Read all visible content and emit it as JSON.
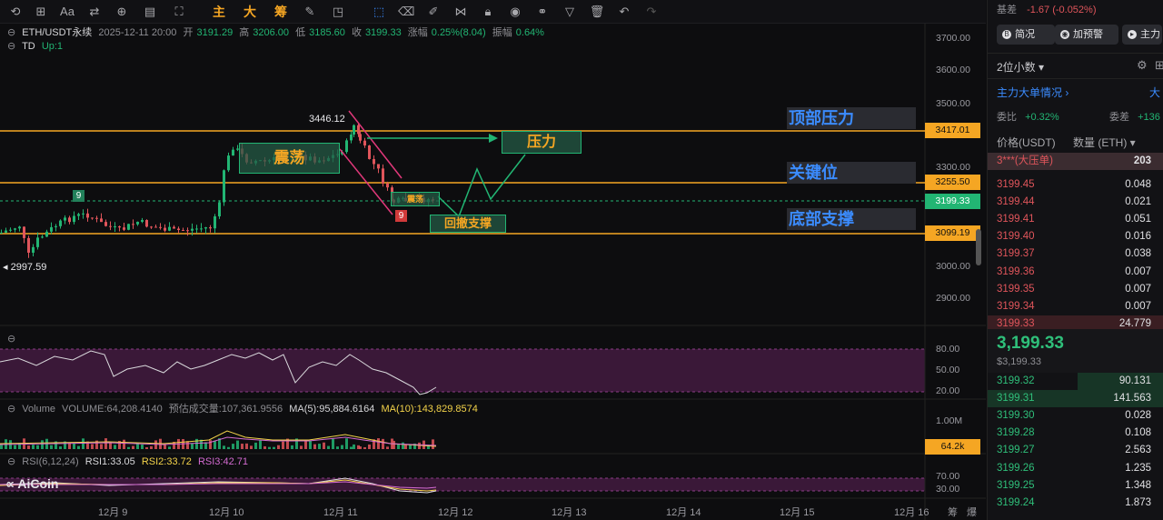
{
  "toolbar": {
    "cn_buttons": [
      "主",
      "大",
      "筹"
    ],
    "icons": [
      "reset-icon",
      "magnet-icon",
      "text-size-icon",
      "bar-style-icon",
      "indicator-icon",
      "layout-icon",
      "fullscreen-icon",
      "edit-icon",
      "screenshot-icon",
      "select-icon",
      "eraser-icon",
      "brush-icon",
      "pattern-icon",
      "lock-icon",
      "eye-icon",
      "link-icon",
      "filter-icon",
      "trash-icon",
      "undo-icon",
      "redo-icon"
    ]
  },
  "chart": {
    "symbol": "ETH/USDT永续",
    "datetime": "2025-12-11 20:00",
    "open_label": "开",
    "open": "3191.29",
    "high_label": "高",
    "high": "3206.00",
    "low_label": "低",
    "low": "3185.60",
    "close_label": "收",
    "close": "3199.33",
    "change_label": "涨幅",
    "change": "0.25%(8.04)",
    "amp_label": "振幅",
    "amp": "0.64%",
    "td_label": "TD",
    "td_value": "Up:1",
    "peak_label": "3446.12",
    "low_mark_label": "2997.59",
    "td9_left": "9",
    "td9_right": "9",
    "annotations": {
      "consolidation": "震荡",
      "consolidation_small": "震荡",
      "resistance": "压力",
      "pullback_support": "回撤支撑"
    },
    "side_labels": {
      "top": "顶部压力",
      "key": "关键位",
      "bottom": "底部支撑"
    },
    "price_axis": [
      "3700.00",
      "3600.00",
      "3500.00",
      "3300.00",
      "3000.00",
      "2900.00"
    ],
    "price_tags": {
      "top": "3417.01",
      "key": "3255.50",
      "current": "3199.33",
      "bottom": "3099.19"
    },
    "osc_axis": [
      "80.00",
      "50.00",
      "20.00"
    ],
    "volume": {
      "label": "Volume",
      "value": "VOLUME:64,208.4140",
      "est": "预估成交量:107,361.9556",
      "ma5": "MA(5):95,884.6164",
      "ma10": "MA(10):143,829.8574",
      "axis_top": "1.00M",
      "tag": "64.2k"
    },
    "rsi": {
      "label": "RSI(6,12,24)",
      "rsi1": "RSI1:33.05",
      "rsi2": "RSI2:33.72",
      "rsi3": "RSI3:42.71",
      "axis": [
        "70.00",
        "30.00"
      ]
    },
    "dates": [
      "12月 9",
      "12月 10",
      "12月 11",
      "12月 12",
      "12月 13",
      "12月 14",
      "12月 15",
      "12月 16"
    ],
    "axis_corner": [
      "筹",
      "爆"
    ],
    "logo": "AiCoin"
  },
  "panel": {
    "basis_label": "基差",
    "basis_value": "-1.67 (-0.052%)",
    "buttons": [
      "简况",
      "加预警",
      "主力"
    ],
    "decimals": "2位小数",
    "main_force": "主力大单情况",
    "main_force_right": "大",
    "ratio_label": "委比",
    "ratio_value": "+0.32%",
    "diff_label": "委差",
    "diff_value": "+136",
    "col_price": "价格(USDT)",
    "col_qty": "数量 (ETH)",
    "big_order": "3***(大压单)",
    "big_order_qty": "203",
    "asks": [
      {
        "p": "3199.45",
        "q": "0.048"
      },
      {
        "p": "3199.44",
        "q": "0.021"
      },
      {
        "p": "3199.41",
        "q": "0.051"
      },
      {
        "p": "3199.40",
        "q": "0.016"
      },
      {
        "p": "3199.37",
        "q": "0.038"
      },
      {
        "p": "3199.36",
        "q": "0.007"
      },
      {
        "p": "3199.35",
        "q": "0.007"
      },
      {
        "p": "3199.34",
        "q": "0.007"
      },
      {
        "p": "3199.33",
        "q": "24.779"
      }
    ],
    "last_price": "3,199.33",
    "last_price_usd": "$3,199.33",
    "bids": [
      {
        "p": "3199.32",
        "q": "90.131"
      },
      {
        "p": "3199.31",
        "q": "141.563"
      },
      {
        "p": "3199.30",
        "q": "0.028"
      },
      {
        "p": "3199.28",
        "q": "0.108"
      },
      {
        "p": "3199.27",
        "q": "2.563"
      },
      {
        "p": "3199.26",
        "q": "1.235"
      },
      {
        "p": "3199.25",
        "q": "1.348"
      },
      {
        "p": "3199.24",
        "q": "1.873"
      }
    ]
  }
}
